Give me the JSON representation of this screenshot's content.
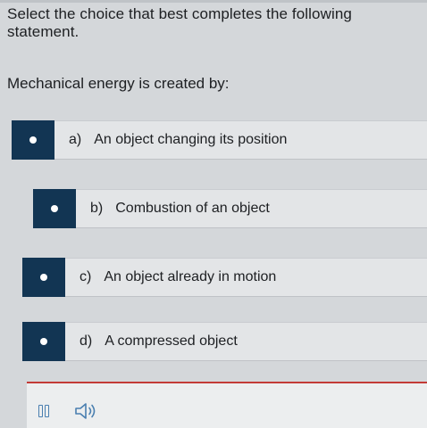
{
  "question": {
    "instruction": "Select the choice that best completes the following statement.",
    "prompt": "Mechanical energy is created by:"
  },
  "choices": [
    {
      "letter": "a)",
      "text": "An object changing its position"
    },
    {
      "letter": "b)",
      "text": "Combustion of an object"
    },
    {
      "letter": "c)",
      "text": "An object already in motion"
    },
    {
      "letter": "d)",
      "text": "A compressed object"
    }
  ],
  "footer": {
    "pause_icon": "pause-icon",
    "audio_icon": "speaker-icon"
  },
  "colors": {
    "marker": "#123553",
    "footer_rule": "#c33a36",
    "icon": "#4a7fb0"
  }
}
